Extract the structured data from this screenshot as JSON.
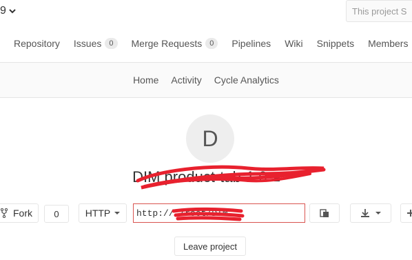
{
  "topbar": {
    "group_fragment": "9",
    "scope_placeholder": "This project S"
  },
  "main_nav": [
    {
      "label": "Repository"
    },
    {
      "label": "Issues",
      "badge": "0"
    },
    {
      "label": "Merge Requests",
      "badge": "0"
    },
    {
      "label": "Pipelines"
    },
    {
      "label": "Wiki"
    },
    {
      "label": "Snippets"
    },
    {
      "label": "Members"
    }
  ],
  "sub_nav": [
    {
      "label": "Home"
    },
    {
      "label": "Activity"
    },
    {
      "label": "Cycle Analytics"
    }
  ],
  "project": {
    "avatar_letter": "D",
    "title_visible": "DIM product-tab-1.0"
  },
  "actions": {
    "fork_label": "Fork",
    "fork_count": "0",
    "protocol": "HTTP",
    "clone_url": "http://                      /root/DIM",
    "leave_label": "Leave project"
  },
  "colors": {
    "redaction": "#e8212e",
    "url_border": "#d9534f"
  }
}
